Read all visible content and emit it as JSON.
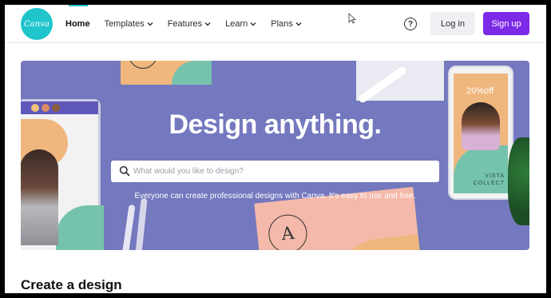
{
  "header": {
    "logo_text": "Canva",
    "nav": [
      {
        "label": "Home",
        "active": true,
        "has_dropdown": false
      },
      {
        "label": "Templates",
        "active": false,
        "has_dropdown": true
      },
      {
        "label": "Features",
        "active": false,
        "has_dropdown": true
      },
      {
        "label": "Learn",
        "active": false,
        "has_dropdown": true
      },
      {
        "label": "Plans",
        "active": false,
        "has_dropdown": true
      }
    ],
    "help_icon": "question-circle-icon",
    "login_label": "Log in",
    "signup_label": "Sign up"
  },
  "hero": {
    "title": "Design anything.",
    "search": {
      "placeholder": "What would you like to design?",
      "value": ""
    },
    "subtitle": "Everyone can create professional designs with Canva. It's easy to use and free.",
    "decor": {
      "card_letter": "A",
      "phone_sale": "20%off",
      "phone_brand": "VISTA COLLECT"
    }
  },
  "section": {
    "title": "Create a design"
  },
  "colors": {
    "brand_teal": "#20c4cb",
    "signup_purple": "#7d2ae8",
    "hero_background": "#7478be",
    "accent_orange": "#efb77e",
    "accent_green": "#75c3ac"
  }
}
